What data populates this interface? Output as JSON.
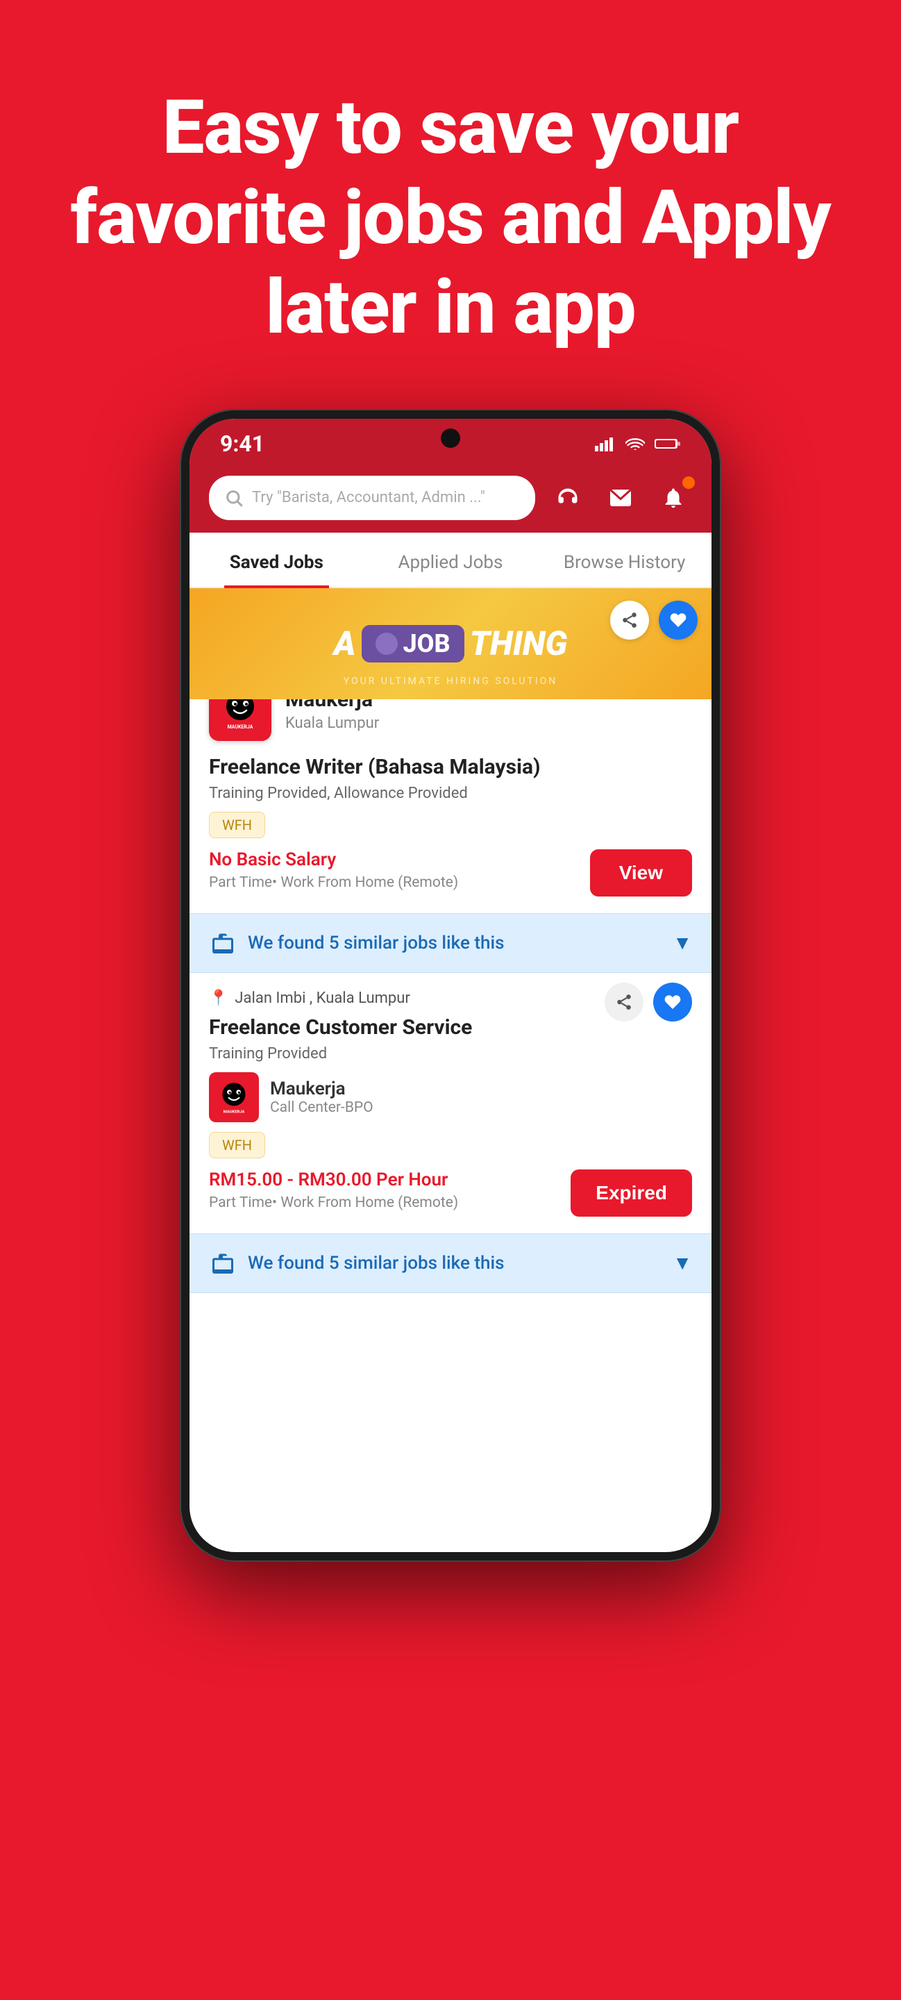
{
  "hero": {
    "title": "Easy to save your favorite jobs and Apply later in app"
  },
  "status_bar": {
    "time": "9:41",
    "signal": "signal-icon",
    "wifi": "wifi-icon",
    "battery": "battery-icon"
  },
  "search": {
    "placeholder": "Try \"Barista, Accountant, Admin ...\""
  },
  "tabs": {
    "items": [
      {
        "label": "Saved Jobs",
        "active": true
      },
      {
        "label": "Applied Jobs",
        "active": false
      },
      {
        "label": "Browse History",
        "active": false
      }
    ]
  },
  "job1": {
    "banner_brand": "A JOB THING",
    "banner_subtitle": "YOUR ULTIMATE HIRING SOLUTION",
    "company_name": "Maukerja",
    "company_location": "Kuala Lumpur",
    "job_title": "Freelance Writer (Bahasa Malaysia)",
    "perks": "Training Provided, Allowance Provided",
    "tag": "WFH",
    "salary": "No Basic Salary",
    "job_type": "Part Time• Work From Home (Remote)",
    "view_button": "View"
  },
  "similar_bar_1": {
    "text": "We found 5 similar jobs like this"
  },
  "job2": {
    "location": "Jalan Imbi , Kuala Lumpur",
    "job_title": "Freelance Customer Service",
    "perks": "Training Provided",
    "company_name": "Maukerja",
    "company_dept": "Call Center-BPO",
    "tag": "WFH",
    "salary": "RM15.00 - RM30.00 Per Hour",
    "job_type": "Part Time• Work From Home (Remote)",
    "expired_button": "Expired"
  },
  "similar_bar_2": {
    "text": "We found 5 similar jobs like this"
  },
  "colors": {
    "brand_red": "#e8192c",
    "brand_blue": "#1877f2",
    "similar_bg": "#ddeeff",
    "similar_text": "#1a6ab5"
  }
}
